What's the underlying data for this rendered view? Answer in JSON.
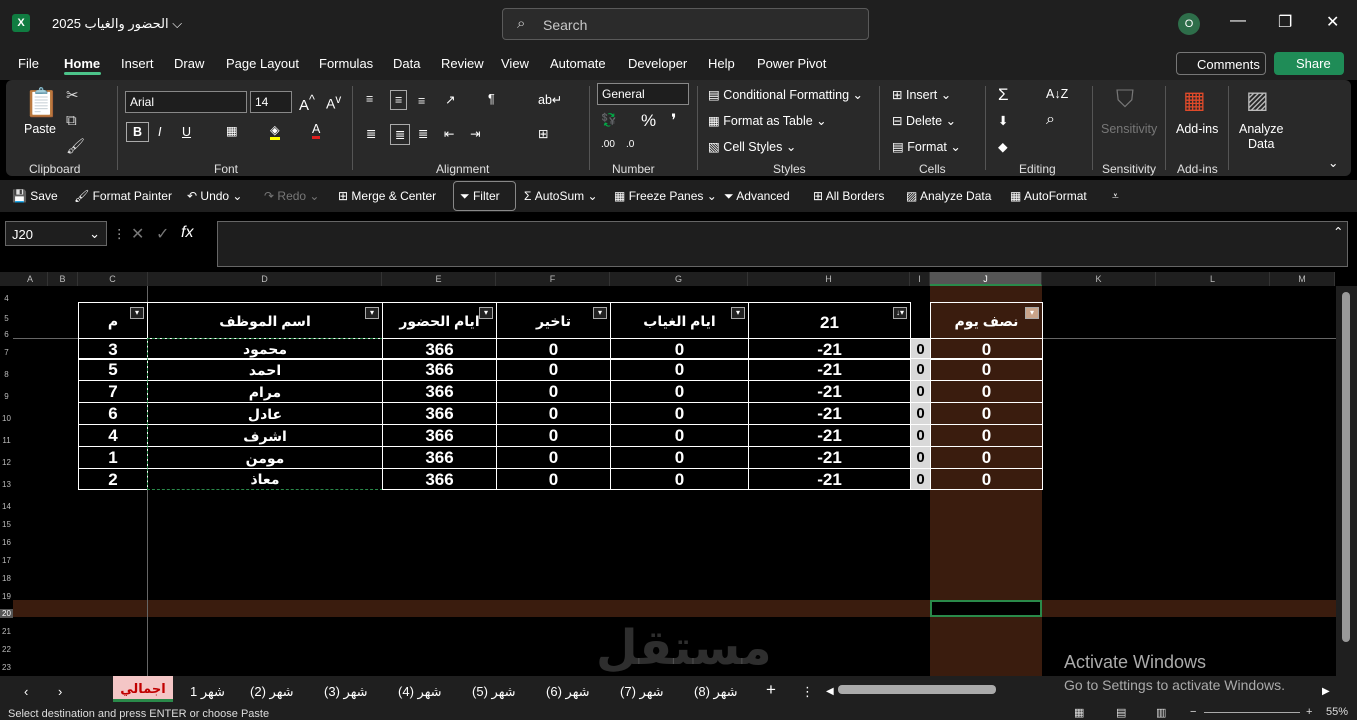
{
  "window": {
    "title": "الحضور والغياب 2025",
    "search_placeholder": "Search",
    "avatar": "O",
    "min": "—",
    "restore": "❐",
    "close": "✕"
  },
  "menu": [
    "File",
    "Home",
    "Insert",
    "Draw",
    "Page Layout",
    "Formulas",
    "Data",
    "Review",
    "View",
    "Automate",
    "Developer",
    "Help",
    "Power Pivot"
  ],
  "comments_label": "Comments",
  "share_label": "Share",
  "ribbon": {
    "paste": "Paste",
    "font_name": "Arial",
    "font_size": "14",
    "number_format": "General",
    "cond_fmt": "Conditional Formatting",
    "fmt_table": "Format as Table",
    "cell_styles": "Cell Styles",
    "insert": "Insert",
    "delete": "Delete",
    "format": "Format",
    "sensitivity": "Sensitivity",
    "addins": "Add-ins",
    "analyze": "Analyze",
    "analyze2": "Data",
    "groups": [
      "Clipboard",
      "Font",
      "Alignment",
      "Number",
      "Styles",
      "Cells",
      "Editing",
      "Sensitivity",
      "Add-ins"
    ]
  },
  "qat": {
    "save": "Save",
    "format_painter": "Format Painter",
    "undo": "Undo",
    "redo": "Redo",
    "merge": "Merge & Center",
    "filter": "Filter",
    "autosum": "AutoSum",
    "freeze": "Freeze Panes",
    "advanced": "Advanced",
    "all_borders": "All Borders",
    "analyze_data": "Analyze Data",
    "autoformat": "AutoFormat"
  },
  "namebox": "J20",
  "columns": [
    "A",
    "B",
    "C",
    "D",
    "E",
    "F",
    "G",
    "H",
    "I",
    "J",
    "K",
    "L",
    "M"
  ],
  "rows": [
    "4",
    "5",
    "6",
    "7",
    "8",
    "9",
    "10",
    "11",
    "12",
    "13",
    "14",
    "15",
    "16",
    "17",
    "18",
    "19",
    "20",
    "21",
    "22",
    "23"
  ],
  "table": {
    "headers": {
      "m": "م",
      "name": "اسم الموظف",
      "attend": "ايام الحضور",
      "late": "تاخير",
      "absent": "ايام الغياب",
      "h": "21",
      "half": "نصف يوم"
    },
    "rows": [
      {
        "m": "3",
        "name": "محمود",
        "attend": "366",
        "late": "0",
        "absent": "0",
        "h": "-21",
        "i": "0",
        "half": "0"
      },
      {
        "m": "5",
        "name": "احمد",
        "attend": "366",
        "late": "0",
        "absent": "0",
        "h": "-21",
        "i": "0",
        "half": "0"
      },
      {
        "m": "7",
        "name": "مرام",
        "attend": "366",
        "late": "0",
        "absent": "0",
        "h": "-21",
        "i": "0",
        "half": "0"
      },
      {
        "m": "6",
        "name": "عادل",
        "attend": "366",
        "late": "0",
        "absent": "0",
        "h": "-21",
        "i": "0",
        "half": "0"
      },
      {
        "m": "4",
        "name": "اشرف",
        "attend": "366",
        "late": "0",
        "absent": "0",
        "h": "-21",
        "i": "0",
        "half": "0"
      },
      {
        "m": "1",
        "name": "مومن",
        "attend": "366",
        "late": "0",
        "absent": "0",
        "h": "-21",
        "i": "0",
        "half": "0"
      },
      {
        "m": "2",
        "name": "معاذ",
        "attend": "366",
        "late": "0",
        "absent": "0",
        "h": "-21",
        "i": "0",
        "half": "0"
      }
    ]
  },
  "sheets": {
    "active": "اجمالي",
    "tabs": [
      "شهر 1",
      "شهر (2)",
      "شهر (3)",
      "شهر (4)",
      "شهر (5)",
      "شهر (6)",
      "شهر (7)",
      "شهر (8)"
    ]
  },
  "status": "Select destination and press ENTER or choose Paste",
  "zoom": "55%",
  "activate": {
    "title": "Activate Windows",
    "sub": "Go to Settings to activate Windows."
  },
  "colors": {
    "accent": "#107c41",
    "share": "#1f8c57",
    "highlight_col": "#3a1c0e",
    "active_tab_bg": "#f4c6c6"
  }
}
